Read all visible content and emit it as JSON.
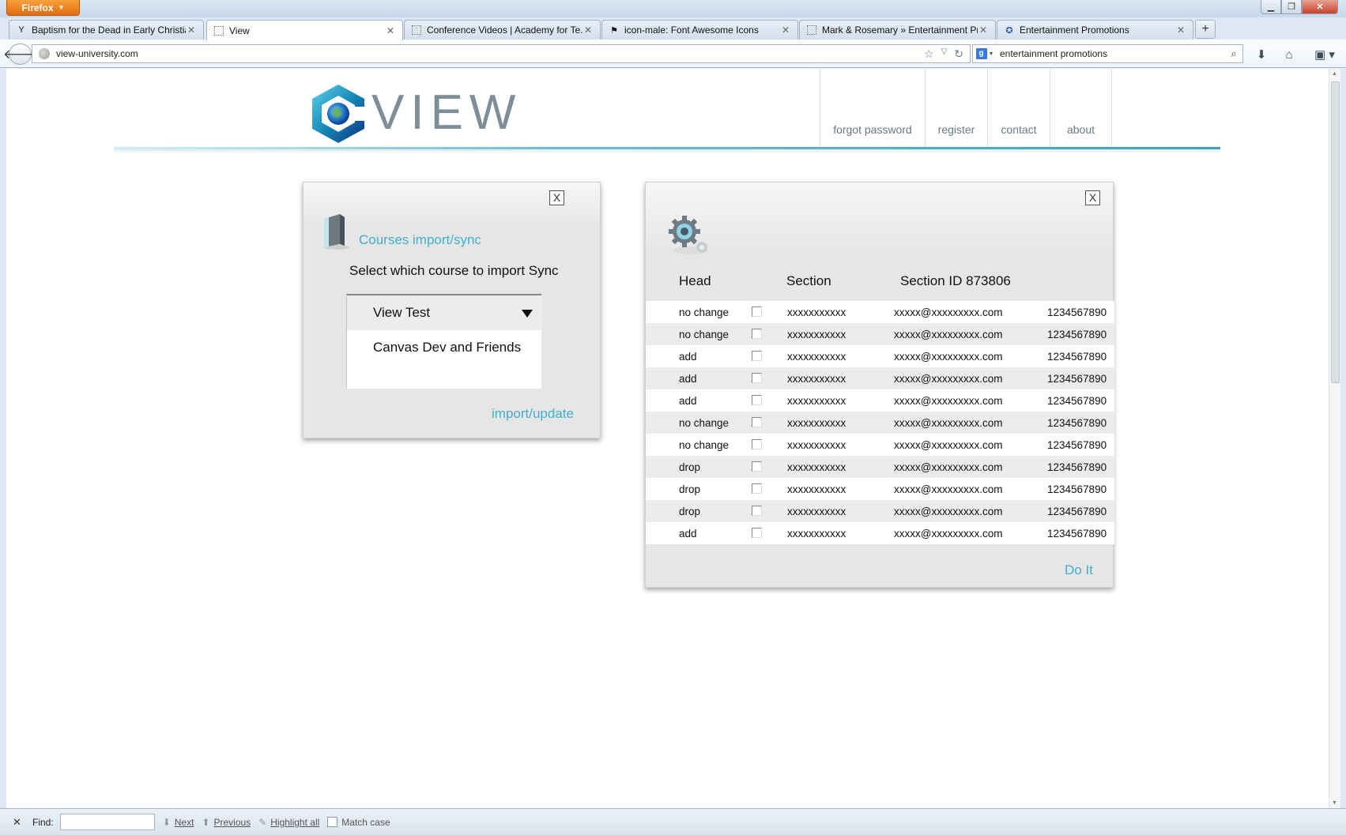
{
  "browser": {
    "app_button": "Firefox",
    "tabs": [
      {
        "label": "Baptism for the Dead in Early Christia...",
        "icon": "y-combinator-icon",
        "active": false
      },
      {
        "label": "View",
        "icon": "blank-page-icon",
        "active": true
      },
      {
        "label": "Conference Videos | Academy for Te...",
        "icon": "blank-page-icon",
        "active": false
      },
      {
        "label": "icon-male: Font Awesome Icons",
        "icon": "flag-icon",
        "active": false
      },
      {
        "label": "Mark & Rosemary » Entertainment Pr...",
        "icon": "blank-page-icon",
        "active": false
      },
      {
        "label": "Entertainment Promotions",
        "icon": "promo-logo-icon",
        "active": false
      }
    ],
    "url": "view-university.com",
    "search": "entertainment promotions",
    "search_engine_glyph": "g"
  },
  "site": {
    "logo_text": "VIEW",
    "nav": [
      "forgot password",
      "register",
      "contact",
      "about"
    ],
    "accent_color": "#3fb1cb"
  },
  "courses_panel": {
    "close": "X",
    "title": "Courses import/sync",
    "prompt": "Select which course to import Sync",
    "selected": "View Test",
    "options": [
      "Canvas Dev and Friends"
    ],
    "action": "import/update"
  },
  "sync_panel": {
    "close": "X",
    "headers": [
      "Head",
      "Section",
      "Section ID 873806"
    ],
    "rows": [
      {
        "head": "no change",
        "section": "xxxxxxxxxxx",
        "email": "xxxxx@xxxxxxxxx.com",
        "phone": "1234567890"
      },
      {
        "head": "no change",
        "section": "xxxxxxxxxxx",
        "email": "xxxxx@xxxxxxxxx.com",
        "phone": "1234567890"
      },
      {
        "head": "add",
        "section": "xxxxxxxxxxx",
        "email": "xxxxx@xxxxxxxxx.com",
        "phone": "1234567890"
      },
      {
        "head": "add",
        "section": "xxxxxxxxxxx",
        "email": "xxxxx@xxxxxxxxx.com",
        "phone": "1234567890"
      },
      {
        "head": "add",
        "section": "xxxxxxxxxxx",
        "email": "xxxxx@xxxxxxxxx.com",
        "phone": "1234567890"
      },
      {
        "head": "no change",
        "section": "xxxxxxxxxxx",
        "email": "xxxxx@xxxxxxxxx.com",
        "phone": "1234567890"
      },
      {
        "head": "no change",
        "section": "xxxxxxxxxxx",
        "email": "xxxxx@xxxxxxxxx.com",
        "phone": "1234567890"
      },
      {
        "head": "drop",
        "section": "xxxxxxxxxxx",
        "email": "xxxxx@xxxxxxxxx.com",
        "phone": "1234567890"
      },
      {
        "head": "drop",
        "section": "xxxxxxxxxxx",
        "email": "xxxxx@xxxxxxxxx.com",
        "phone": "1234567890"
      },
      {
        "head": "drop",
        "section": "xxxxxxxxxxx",
        "email": "xxxxx@xxxxxxxxx.com",
        "phone": "1234567890"
      },
      {
        "head": "add",
        "section": "xxxxxxxxxxx",
        "email": "xxxxx@xxxxxxxxx.com",
        "phone": "1234567890"
      }
    ],
    "action": "Do It"
  },
  "findbar": {
    "label": "Find:",
    "value": "",
    "next": "Next",
    "previous": "Previous",
    "highlight": "Highlight all",
    "match_case": "Match case"
  }
}
